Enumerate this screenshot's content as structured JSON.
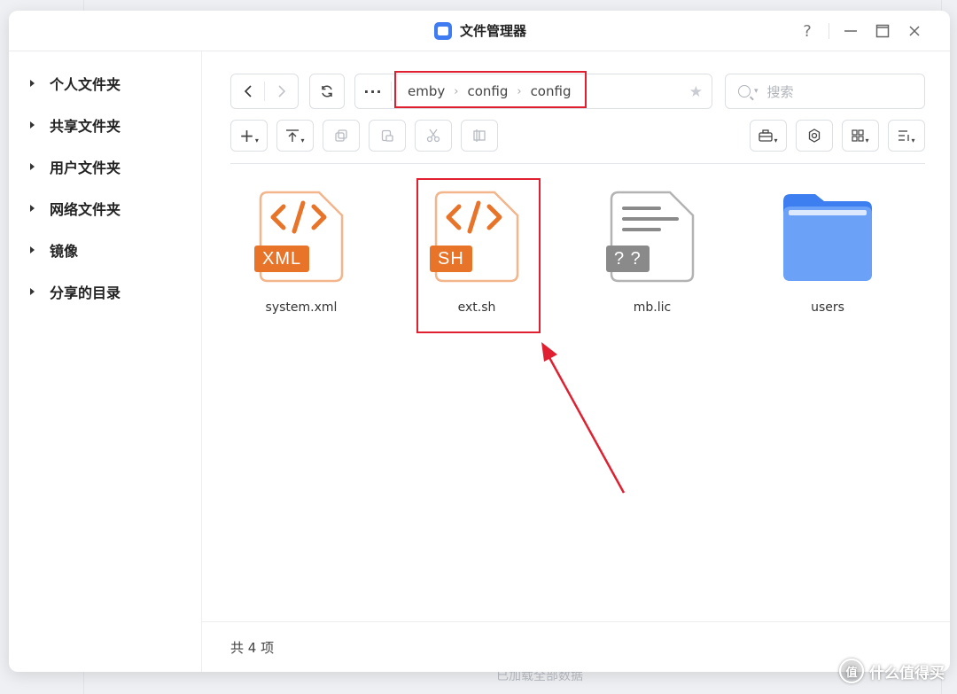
{
  "window": {
    "title": "文件管理器"
  },
  "title_controls": {
    "help": "?",
    "minimize": "—",
    "maximize": "☐",
    "close": "✕"
  },
  "sidebar": {
    "items": [
      {
        "label": "个人文件夹"
      },
      {
        "label": "共享文件夹"
      },
      {
        "label": "用户文件夹"
      },
      {
        "label": "网络文件夹"
      },
      {
        "label": "镜像"
      },
      {
        "label": "分享的目录"
      }
    ]
  },
  "nav": {
    "back": "‹",
    "forward": "›",
    "refresh": "⟳",
    "more": "···"
  },
  "breadcrumb": {
    "items": [
      "emby",
      "config",
      "config"
    ],
    "separator": "›"
  },
  "search": {
    "placeholder": "搜索"
  },
  "toolbar": {
    "new": "+",
    "upload": "⤒",
    "copy": "⧉",
    "paste": "⎘",
    "cut": "✂",
    "rename": "⎗",
    "right": [
      "briefcase",
      "settings",
      "grid-view",
      "sort"
    ]
  },
  "files": [
    {
      "name": "system.xml",
      "badge": "XML",
      "type": "code",
      "color": "#e8742a"
    },
    {
      "name": "ext.sh",
      "badge": "SH",
      "type": "code",
      "color": "#e8742a"
    },
    {
      "name": "mb.lic",
      "badge": "? ?",
      "type": "unknown",
      "color": "#8a8a8a"
    },
    {
      "name": "users",
      "badge": "",
      "type": "folder",
      "color": "#4f8ef7"
    }
  ],
  "status": {
    "count": "共 4 项"
  },
  "background": {
    "bottom_text": "已加载全部数据"
  },
  "watermark": {
    "logo": "值",
    "text": "什么值得买"
  },
  "colors": {
    "accent": "#3f7cf2",
    "highlight": "#e02030",
    "code_orange": "#e8742a"
  }
}
